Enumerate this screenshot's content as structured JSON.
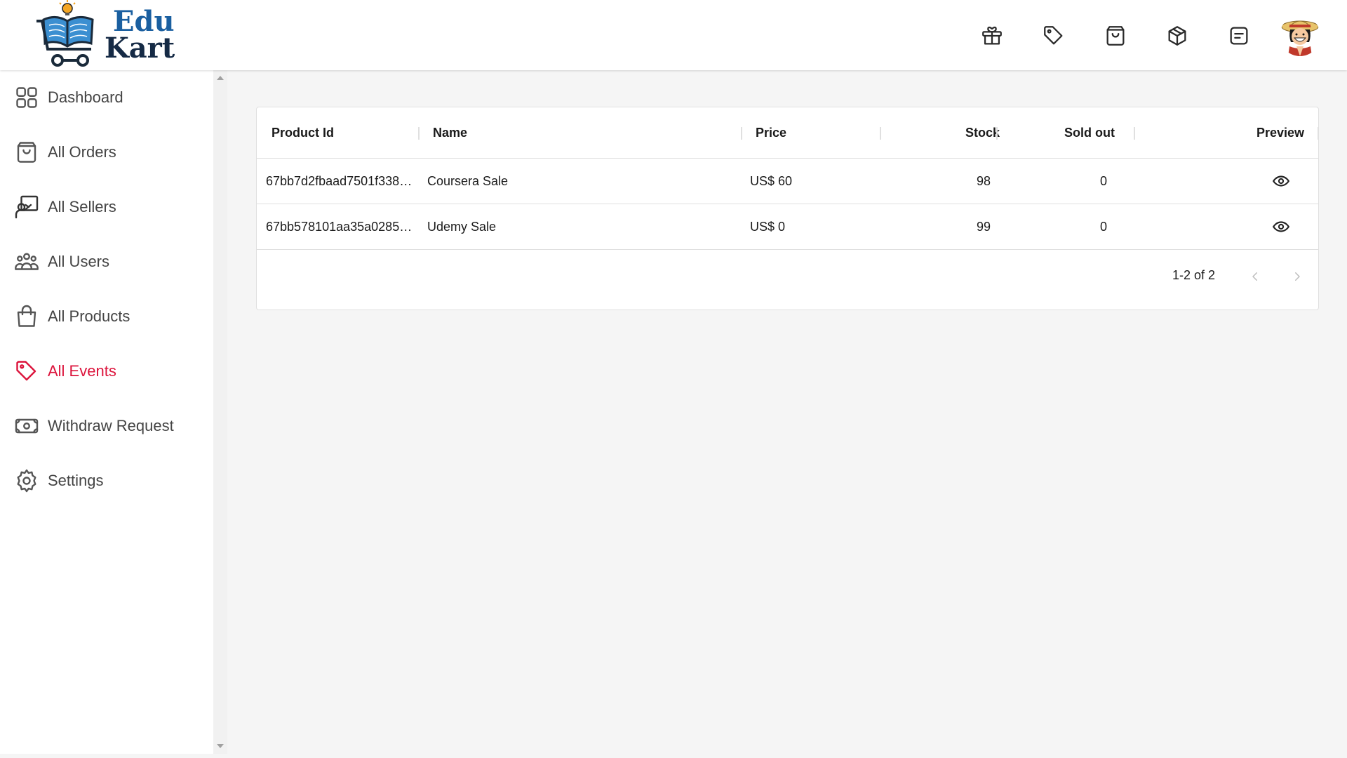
{
  "brand": {
    "line1": "Edu",
    "line2": "Kart"
  },
  "header_icons": [
    "gift-icon",
    "tag-icon",
    "shopping-bag-icon",
    "package-icon",
    "message-icon"
  ],
  "sidebar": {
    "items": [
      {
        "label": "Dashboard",
        "icon": "grid-icon",
        "active": false
      },
      {
        "label": "All Orders",
        "icon": "shopping-bag-icon",
        "active": false
      },
      {
        "label": "All Sellers",
        "icon": "seller-icon",
        "active": false
      },
      {
        "label": "All Users",
        "icon": "users-icon",
        "active": false
      },
      {
        "label": "All Products",
        "icon": "handbag-icon",
        "active": false
      },
      {
        "label": "All Events",
        "icon": "tag-icon",
        "active": true
      },
      {
        "label": "Withdraw Request",
        "icon": "money-icon",
        "active": false
      },
      {
        "label": "Settings",
        "icon": "gear-icon",
        "active": false
      }
    ],
    "active_color": "#dc143c"
  },
  "table": {
    "headers": [
      "Product Id",
      "Name",
      "Price",
      "Stock",
      "Sold out",
      "Preview"
    ],
    "rows": [
      {
        "id": "67bb7d2fbaad7501f338…",
        "name": "Coursera Sale",
        "price": "US$ 60",
        "stock": "98",
        "sold": "0"
      },
      {
        "id": "67bb578101aa35a0285…",
        "name": "Udemy Sale",
        "price": "US$ 0",
        "stock": "99",
        "sold": "0"
      }
    ],
    "pagination": "1-2 of 2"
  }
}
